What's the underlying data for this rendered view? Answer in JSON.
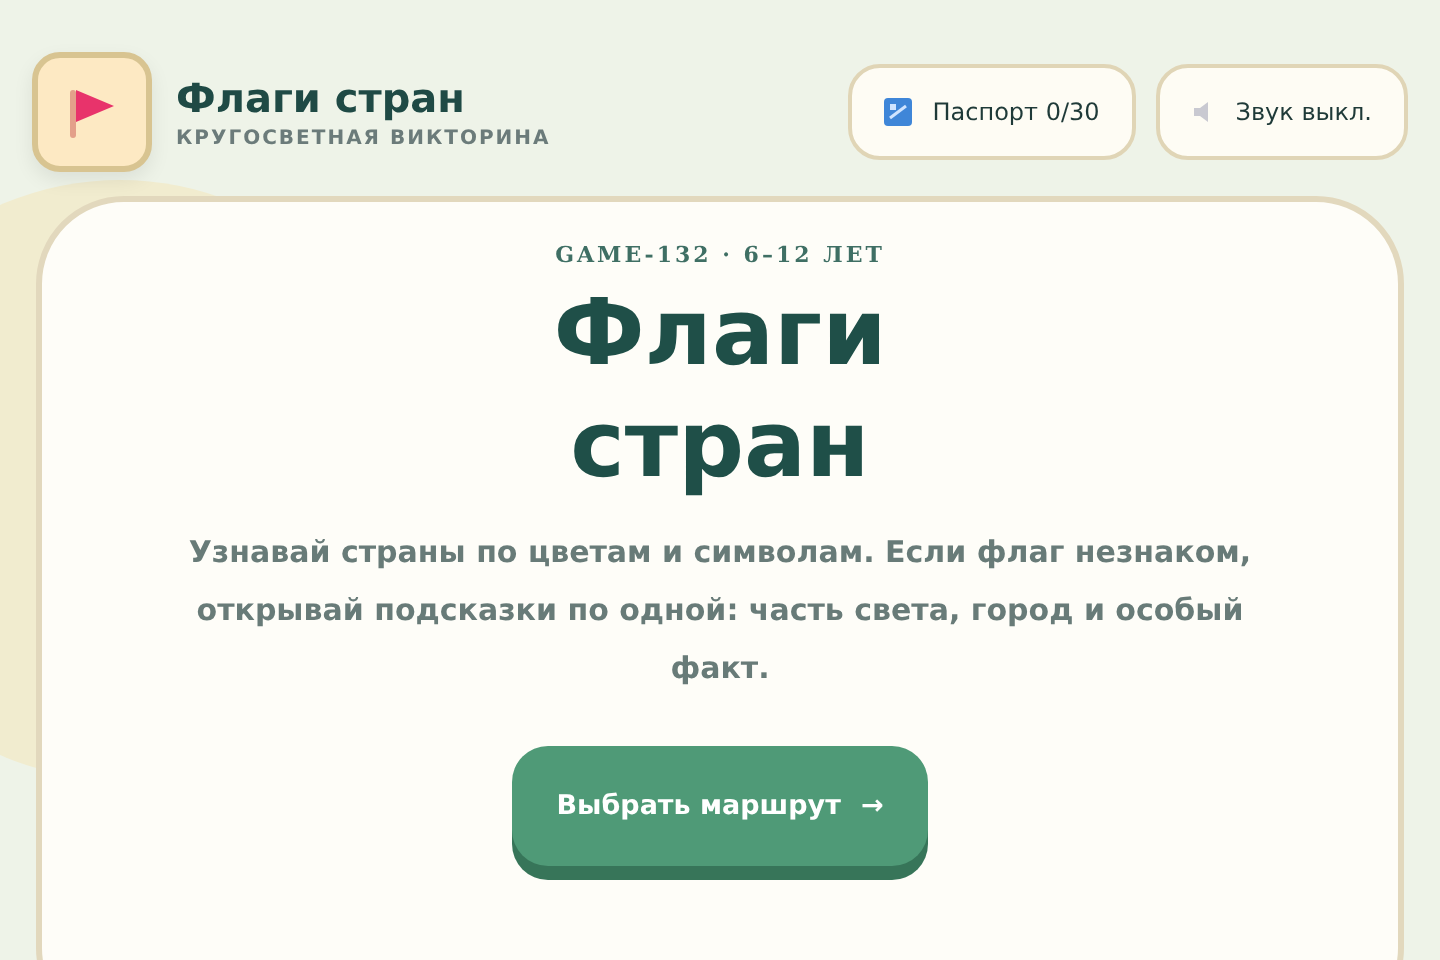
{
  "header": {
    "title": "Флаги стран",
    "subtitle": "КРУГОСВЕТНАЯ ВИКТОРИНА",
    "buttons": [
      {
        "kind": "passport",
        "label": "Паспорт 0/30"
      },
      {
        "kind": "sound",
        "label": "Звук выкл."
      }
    ]
  },
  "hero": {
    "eyebrow": "GAME-132 · 6–12 ЛЕТ",
    "title": "Флаги стран",
    "description": "Узнавай страны по цветам и символам. Если флаг незнаком, открывай подсказки по одной: часть света, город и особый факт.",
    "cta": {
      "label": "Выбрать маршрут",
      "arrow": "→"
    }
  }
}
